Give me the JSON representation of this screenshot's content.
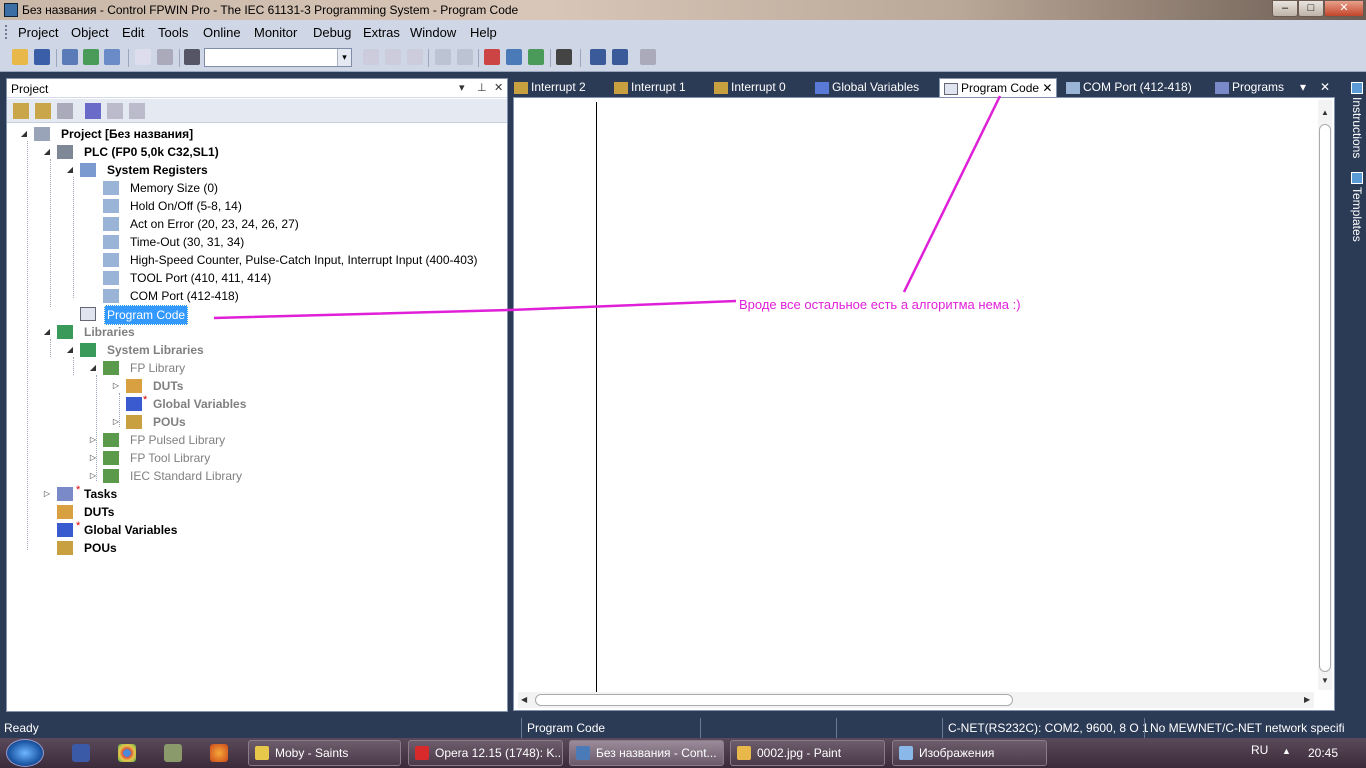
{
  "window": {
    "title": "Без названия - Control FPWIN Pro - The IEC 61131-3 Programming System - Program Code",
    "min": "–",
    "max": "□",
    "close": "✕"
  },
  "menu": [
    "Project",
    "Object",
    "Edit",
    "Tools",
    "Online",
    "Monitor",
    "Debug",
    "Extras",
    "Window",
    "Help"
  ],
  "toolbar": {
    "combo_value": "",
    "combo_arrow": "▾"
  },
  "project_panel": {
    "title": "Project",
    "dropdown": "▾",
    "pin": "⊥",
    "close": "✕"
  },
  "tree": {
    "root": "Project [Без названия]",
    "plc": "PLC (FP0 5,0k C32,SL1)",
    "system_registers": "System Registers",
    "registers": [
      "Memory Size (0)",
      "Hold On/Off (5-8, 14)",
      "Act on Error (20, 23, 24, 26, 27)",
      "Time-Out (30, 31, 34)",
      "High-Speed Counter, Pulse-Catch Input, Interrupt Input (400-403)",
      "TOOL Port (410, 411, 414)",
      "COM Port (412-418)"
    ],
    "program_code": "Program Code",
    "libraries": "Libraries",
    "system_libraries": "System Libraries",
    "fp_library": "FP Library",
    "duts_lib": "DUTs",
    "global_vars_lib": "Global Variables",
    "pous_lib": "POUs",
    "other_libs": [
      "FP Pulsed Library",
      "FP Tool Library",
      "IEC Standard Library"
    ],
    "tasks": "Tasks",
    "duts": "DUTs",
    "global_vars": "Global Variables",
    "pous": "POUs",
    "star": "*",
    "collapse": "◢",
    "expand": "▷"
  },
  "tabs": [
    {
      "label": "Interrupt 2"
    },
    {
      "label": "Interrupt 1"
    },
    {
      "label": "Interrupt 0"
    },
    {
      "label": "Global Variables"
    },
    {
      "label": "Program Code"
    },
    {
      "label": "COM Port (412-418)"
    },
    {
      "label": "Programs"
    }
  ],
  "tab_close": "✕",
  "tab_controls": {
    "dropdown": "▾",
    "close": "✕"
  },
  "side_tabs": [
    "Instructions",
    "Templates"
  ],
  "annotation": "Вроде все остальное есть а алгоритма нема :)",
  "annotation_color": "#e020d8",
  "scroll_arrows": {
    "up": "▲",
    "down": "▼",
    "left": "◀",
    "right": "▶"
  },
  "status": [
    "Ready",
    "Program Code",
    "C-NET(RS232C): COM2, 9600, 8 O 1",
    "No MEWNET/C-NET network specifi"
  ],
  "taskbar": {
    "tasks": [
      "Moby - Saints",
      "Opera 12.15 (1748): K...",
      "Без названия - Cont...",
      "0002.jpg - Paint",
      "Изображения"
    ],
    "lang": "RU",
    "tray_arrow": "▲",
    "time": "20:45"
  }
}
